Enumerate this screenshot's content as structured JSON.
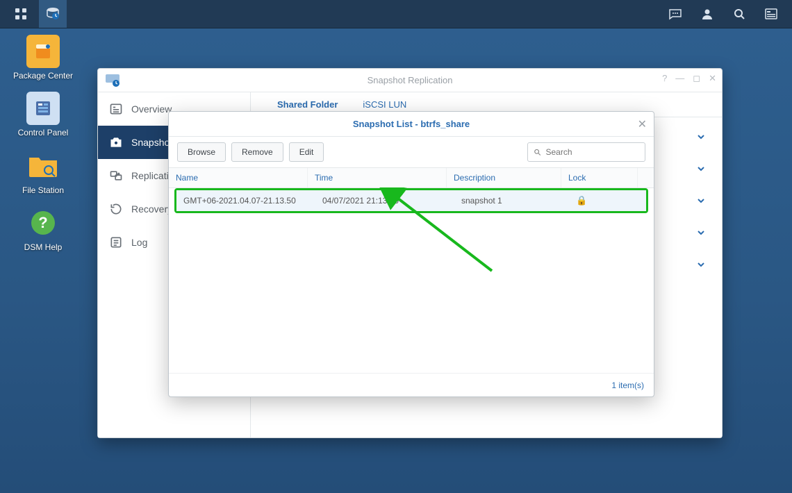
{
  "taskbar": {
    "icons_left": [
      "apps",
      "backup-app"
    ],
    "icons_right": [
      "chat",
      "user",
      "search",
      "widgets"
    ]
  },
  "desktop": [
    {
      "name": "package-center",
      "label": "Package Center",
      "color": "#f5b53a"
    },
    {
      "name": "control-panel",
      "label": "Control Panel",
      "color": "#4a6ea9"
    },
    {
      "name": "file-station",
      "label": "File Station",
      "color": "#f5b53a"
    },
    {
      "name": "dsm-help",
      "label": "DSM Help",
      "color": "#57b54d"
    }
  ],
  "window": {
    "title": "Snapshot Replication",
    "sidebar": [
      {
        "key": "overview",
        "label": "Overview"
      },
      {
        "key": "snapshots",
        "label": "Snapshots",
        "active": true
      },
      {
        "key": "replication",
        "label": "Replication"
      },
      {
        "key": "recovery",
        "label": "Recovery"
      },
      {
        "key": "log",
        "label": "Log"
      }
    ],
    "tabs": [
      {
        "label": "Shared Folder",
        "active": true
      },
      {
        "label": "iSCSI LUN",
        "active": false
      }
    ]
  },
  "modal": {
    "title": "Snapshot List - btrfs_share",
    "toolbar": {
      "browse": "Browse",
      "remove": "Remove",
      "edit": "Edit",
      "search_placeholder": "Search"
    },
    "columns": {
      "name": "Name",
      "time": "Time",
      "description": "Description",
      "lock": "Lock"
    },
    "rows": [
      {
        "name": "GMT+06-2021.04.07-21.13.50",
        "time": "04/07/2021 21:13:50",
        "description": "snapshot 1",
        "locked": true
      }
    ],
    "footer": "1 item(s)"
  }
}
